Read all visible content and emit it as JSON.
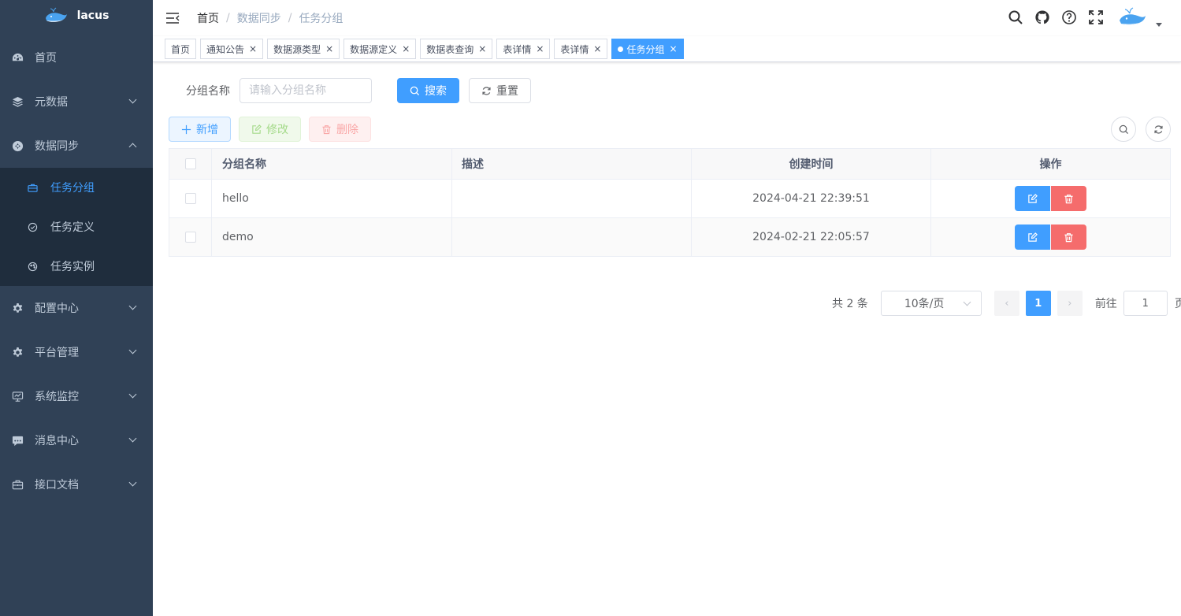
{
  "app": {
    "name": "lacus"
  },
  "sidebar": {
    "items": [
      {
        "label": "首页"
      },
      {
        "label": "元数据"
      },
      {
        "label": "数据同步"
      },
      {
        "label": "配置中心"
      },
      {
        "label": "平台管理"
      },
      {
        "label": "系统监控"
      },
      {
        "label": "消息中心"
      },
      {
        "label": "接口文档"
      }
    ],
    "sub_items": [
      {
        "label": "任务分组",
        "active": true
      },
      {
        "label": "任务定义"
      },
      {
        "label": "任务实例"
      }
    ]
  },
  "breadcrumb": [
    "首页",
    "数据同步",
    "任务分组"
  ],
  "tags": [
    {
      "label": "首页"
    },
    {
      "label": "通知公告"
    },
    {
      "label": "数据源类型"
    },
    {
      "label": "数据源定义"
    },
    {
      "label": "数据表查询"
    },
    {
      "label": "表详情"
    },
    {
      "label": "表详情"
    },
    {
      "label": "任务分组",
      "active": true
    }
  ],
  "search": {
    "label": "分组名称",
    "placeholder": "请输入分组名称",
    "search_btn": "搜索",
    "reset_btn": "重置"
  },
  "toolbar": {
    "add": "新增",
    "edit": "修改",
    "delete": "删除"
  },
  "table": {
    "columns": [
      "分组名称",
      "描述",
      "创建时间",
      "操作"
    ],
    "rows": [
      {
        "name": "hello",
        "desc": "",
        "created": "2024-04-21 22:39:51"
      },
      {
        "name": "demo",
        "desc": "",
        "created": "2024-02-21 22:05:57"
      }
    ]
  },
  "pagination": {
    "total_text": "共 2 条",
    "page_size": "10条/页",
    "current_page": "1",
    "goto_label": "前往",
    "goto_value": "1",
    "page_suffix": "页"
  },
  "colors": {
    "primary": "#409eff",
    "danger": "#f56c6c",
    "sidebar_bg": "#304156",
    "submenu_bg": "#1f2d3d"
  }
}
